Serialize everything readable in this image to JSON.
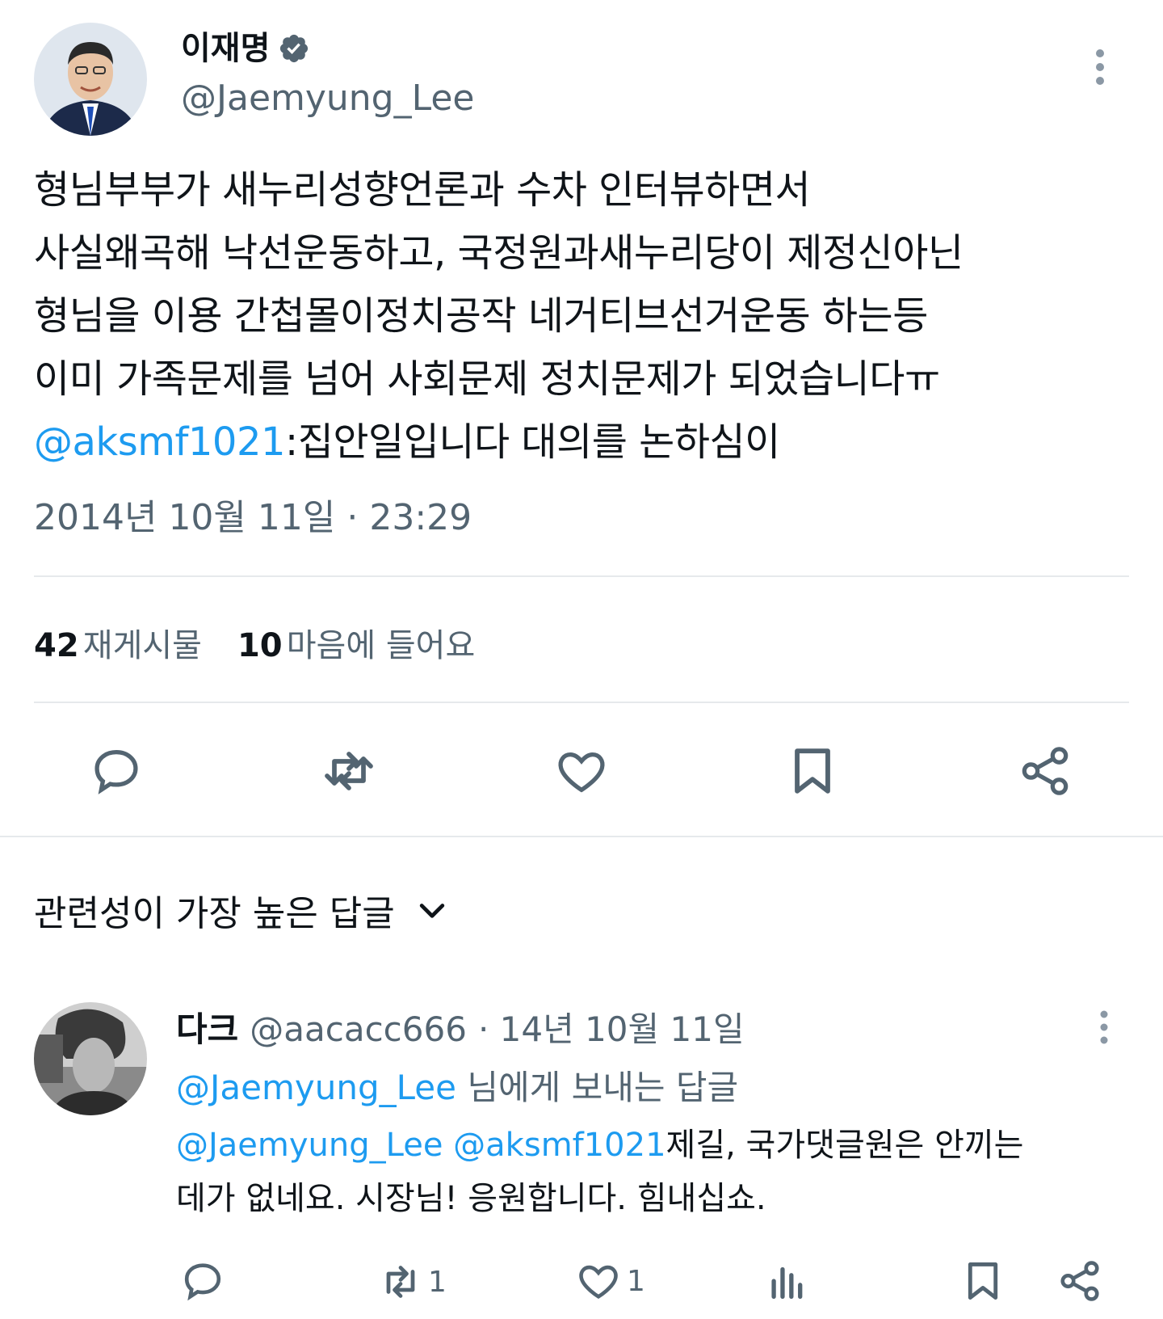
{
  "tweet": {
    "author_name": "이재명",
    "author_handle": "@Jaemyung_Lee",
    "lines": [
      "형님부부가 새누리성향언론과 수차 인터뷰하면서",
      "사실왜곡해 낙선운동하고, 국정원과새누리당이 제정신아닌",
      "형님을 이용 간첩몰이정치공작 네거티브선거운동 하는등",
      "이미 가족문제를 넘어 사회문제 정치문제가 되었습니다ㅠ"
    ],
    "mention": "@aksmf1021",
    "last_line_rest": ":집안일입니다 대의를 논하심이",
    "timestamp": "2014년 10월 11일 · 23:29"
  },
  "stats": {
    "reposts_count": "42",
    "reposts_label": "재게시물",
    "likes_count": "10",
    "likes_label": "마음에 들어요"
  },
  "replies_sort": {
    "label": "관련성이 가장 높은 답글"
  },
  "reply": {
    "author_name": "다크",
    "author_handle": "@aacacc666",
    "date": "· 14년 10월 11일",
    "replying_to_mention": "@Jaemyung_Lee",
    "replying_to_suffix": "님에게 보내는 답글",
    "text_mention1": "@Jaemyung_Lee",
    "text_mention2": "@aksmf1021",
    "text_line1_rest": "제길, 국가댓글원은 안끼는",
    "text_line2": "데가 없네요. 시장님! 응원합니다. 힘내십쇼.",
    "retweet_count": "1",
    "like_count": "1"
  },
  "colors": {
    "accent": "#1d9bf0",
    "secondary_text": "#536471",
    "divider": "#e6e9ec"
  },
  "icons": [
    "verified-badge-icon",
    "more-icon",
    "reply-icon",
    "retweet-icon",
    "like-icon",
    "bookmark-icon",
    "share-icon",
    "chevron-down-icon",
    "views-icon"
  ]
}
